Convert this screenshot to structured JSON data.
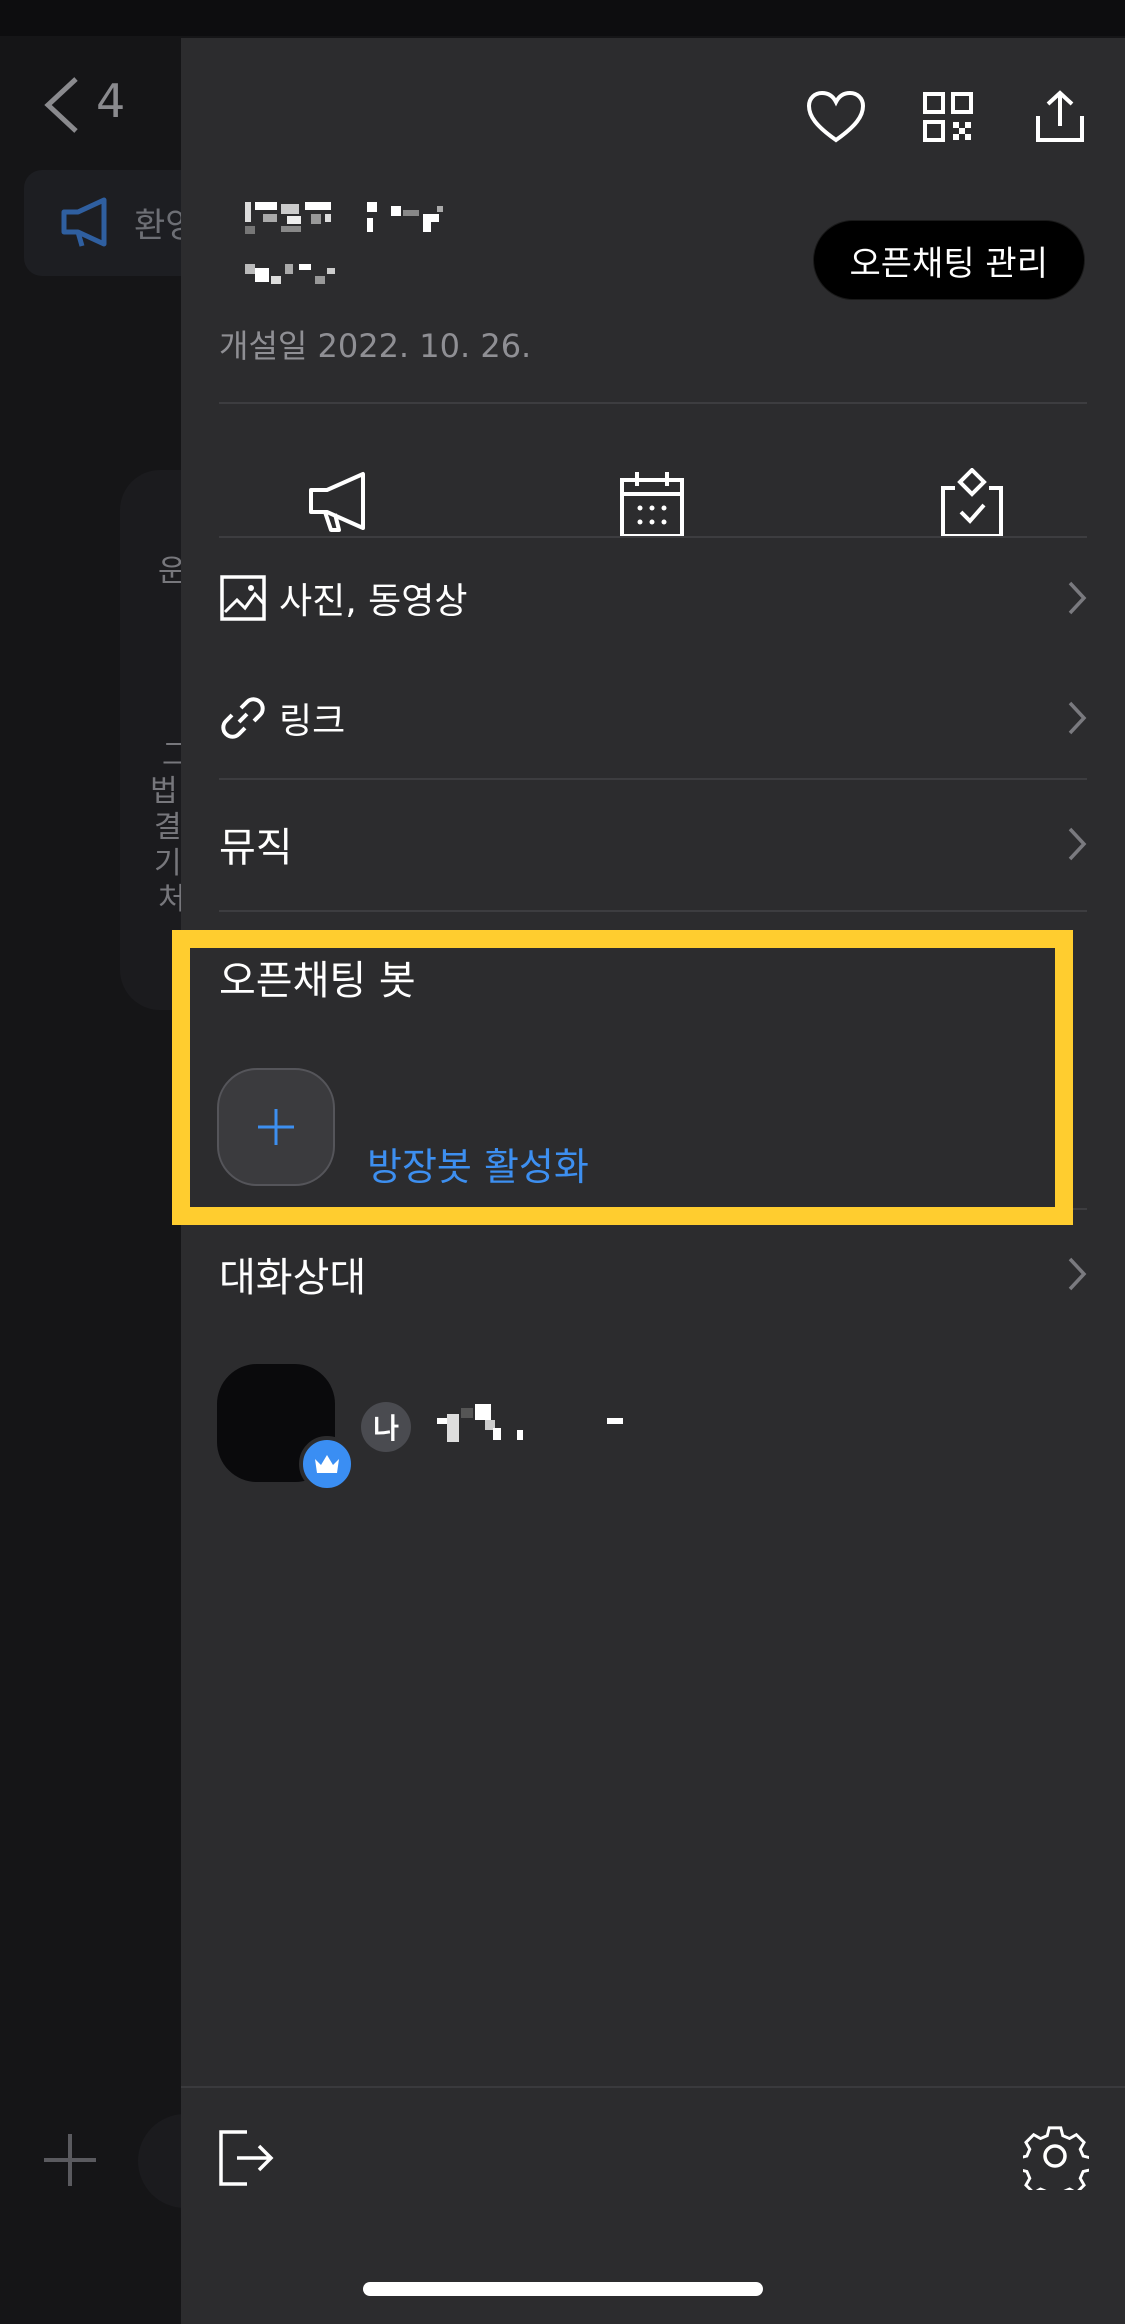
{
  "background": {
    "member_count": "4",
    "notice_text": "환영",
    "card_chars": [
      "운",
      "그",
      "법",
      "결",
      "기",
      "처"
    ]
  },
  "drawer": {
    "manage_button": "오픈채팅 관리",
    "created_label": "개설일 2022. 10. 26.",
    "menu": [
      {
        "label": "사진, 동영상",
        "icon": "photo-icon"
      },
      {
        "label": "링크",
        "icon": "link-icon"
      },
      {
        "label": "뮤직"
      }
    ],
    "bot_section": {
      "title": "오픈채팅 봇",
      "add_label": "방장봇 활성화"
    },
    "members_section": {
      "title": "대화상대",
      "me_badge": "나"
    }
  },
  "colors": {
    "drawer_bg": "#2c2c2e",
    "accent_blue": "#3d8ff0",
    "highlight": "#ffcd2f"
  }
}
